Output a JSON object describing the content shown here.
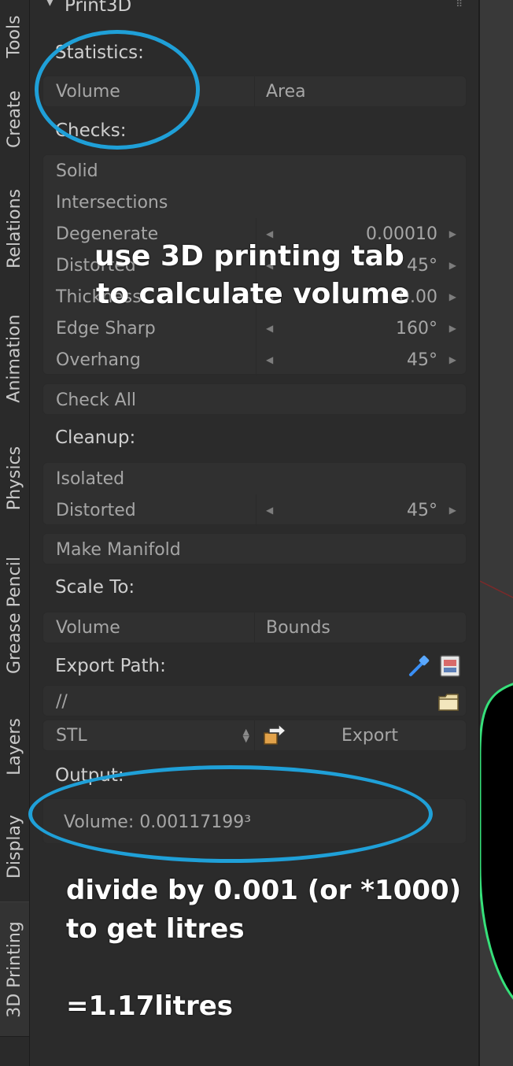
{
  "tabs": [
    {
      "label": "Tools"
    },
    {
      "label": "Create"
    },
    {
      "label": "Relations"
    },
    {
      "label": "Animation"
    },
    {
      "label": "Physics"
    },
    {
      "label": "Grease Pencil"
    },
    {
      "label": "Layers"
    },
    {
      "label": "Display"
    },
    {
      "label": "3D Printing"
    }
  ],
  "panel": {
    "title": "Print3D",
    "statistics": {
      "heading": "Statistics:",
      "volume": "Volume",
      "area": "Area"
    },
    "checks": {
      "heading": "Checks:",
      "solid": "Solid",
      "intersections": "Intersections",
      "degenerate": {
        "label": "Degenerate",
        "value": "0.00010"
      },
      "distorted": {
        "label": "Distorted",
        "value": "45°"
      },
      "thickness": {
        "label": "Thickness",
        "value": "0.00"
      },
      "edge_sharp": {
        "label": "Edge Sharp",
        "value": "160°"
      },
      "overhang": {
        "label": "Overhang",
        "value": "45°"
      },
      "check_all": "Check All"
    },
    "cleanup": {
      "heading": "Cleanup:",
      "isolated": "Isolated",
      "distorted": {
        "label": "Distorted",
        "value": "45°"
      },
      "make_manifold": "Make Manifold"
    },
    "scale_to": {
      "heading": "Scale To:",
      "volume": "Volume",
      "bounds": "Bounds"
    },
    "export": {
      "heading": "Export Path:",
      "path": "//",
      "format": "STL",
      "export_label": "Export"
    },
    "output": {
      "heading": "Output:",
      "volume": "Volume: 0.00117199³"
    }
  },
  "annotations": {
    "line1": "use 3D printing tab",
    "line2": "to calculate volume",
    "divide1": "divide by 0.001 (or *1000)",
    "divide2": "to get litres",
    "result": "=1.17litres"
  },
  "colors": {
    "annotation_ellipse": "#1fa0d8",
    "viewport_curve": "#36e07a"
  }
}
